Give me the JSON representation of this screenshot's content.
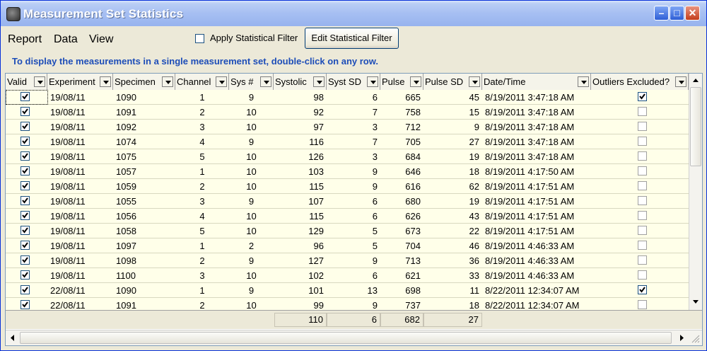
{
  "window": {
    "title": "Measurement Set Statistics"
  },
  "menu": {
    "items": [
      "Report",
      "Data",
      "View"
    ]
  },
  "toolbar": {
    "filter_checkbox_label": "Apply Statistical Filter",
    "filter_checked": false,
    "edit_button_label": "Edit Statistical Filter"
  },
  "info_text": "To display the measurements in a single measurement set, double-click on any row.",
  "columns": [
    "Valid",
    "Experiment",
    "Specimen",
    "Channel",
    "Sys #",
    "Systolic",
    "Syst SD",
    "Pulse",
    "Pulse SD",
    "Date/Time",
    "Outliers Excluded?"
  ],
  "rows": [
    {
      "valid": true,
      "experiment": "19/08/11",
      "specimen": "1090",
      "channel": "1",
      "sys": "9",
      "systolic": "98",
      "syst_sd": "6",
      "pulse": "665",
      "pulse_sd": "45",
      "datetime": "8/19/2011 3:47:18 AM",
      "outliers": true
    },
    {
      "valid": true,
      "experiment": "19/08/11",
      "specimen": "1091",
      "channel": "2",
      "sys": "10",
      "systolic": "92",
      "syst_sd": "7",
      "pulse": "758",
      "pulse_sd": "15",
      "datetime": "8/19/2011 3:47:18 AM",
      "outliers": false
    },
    {
      "valid": true,
      "experiment": "19/08/11",
      "specimen": "1092",
      "channel": "3",
      "sys": "10",
      "systolic": "97",
      "syst_sd": "3",
      "pulse": "712",
      "pulse_sd": "9",
      "datetime": "8/19/2011 3:47:18 AM",
      "outliers": false
    },
    {
      "valid": true,
      "experiment": "19/08/11",
      "specimen": "1074",
      "channel": "4",
      "sys": "9",
      "systolic": "116",
      "syst_sd": "7",
      "pulse": "705",
      "pulse_sd": "27",
      "datetime": "8/19/2011 3:47:18 AM",
      "outliers": false
    },
    {
      "valid": true,
      "experiment": "19/08/11",
      "specimen": "1075",
      "channel": "5",
      "sys": "10",
      "systolic": "126",
      "syst_sd": "3",
      "pulse": "684",
      "pulse_sd": "19",
      "datetime": "8/19/2011 3:47:18 AM",
      "outliers": false
    },
    {
      "valid": true,
      "experiment": "19/08/11",
      "specimen": "1057",
      "channel": "1",
      "sys": "10",
      "systolic": "103",
      "syst_sd": "9",
      "pulse": "646",
      "pulse_sd": "18",
      "datetime": "8/19/2011 4:17:50 AM",
      "outliers": false
    },
    {
      "valid": true,
      "experiment": "19/08/11",
      "specimen": "1059",
      "channel": "2",
      "sys": "10",
      "systolic": "115",
      "syst_sd": "9",
      "pulse": "616",
      "pulse_sd": "62",
      "datetime": "8/19/2011 4:17:51 AM",
      "outliers": false
    },
    {
      "valid": true,
      "experiment": "19/08/11",
      "specimen": "1055",
      "channel": "3",
      "sys": "9",
      "systolic": "107",
      "syst_sd": "6",
      "pulse": "680",
      "pulse_sd": "19",
      "datetime": "8/19/2011 4:17:51 AM",
      "outliers": false
    },
    {
      "valid": true,
      "experiment": "19/08/11",
      "specimen": "1056",
      "channel": "4",
      "sys": "10",
      "systolic": "115",
      "syst_sd": "6",
      "pulse": "626",
      "pulse_sd": "43",
      "datetime": "8/19/2011 4:17:51 AM",
      "outliers": false
    },
    {
      "valid": true,
      "experiment": "19/08/11",
      "specimen": "1058",
      "channel": "5",
      "sys": "10",
      "systolic": "129",
      "syst_sd": "5",
      "pulse": "673",
      "pulse_sd": "22",
      "datetime": "8/19/2011 4:17:51 AM",
      "outliers": false
    },
    {
      "valid": true,
      "experiment": "19/08/11",
      "specimen": "1097",
      "channel": "1",
      "sys": "2",
      "systolic": "96",
      "syst_sd": "5",
      "pulse": "704",
      "pulse_sd": "46",
      "datetime": "8/19/2011 4:46:33 AM",
      "outliers": false
    },
    {
      "valid": true,
      "experiment": "19/08/11",
      "specimen": "1098",
      "channel": "2",
      "sys": "9",
      "systolic": "127",
      "syst_sd": "9",
      "pulse": "713",
      "pulse_sd": "36",
      "datetime": "8/19/2011 4:46:33 AM",
      "outliers": false
    },
    {
      "valid": true,
      "experiment": "19/08/11",
      "specimen": "1100",
      "channel": "3",
      "sys": "10",
      "systolic": "102",
      "syst_sd": "6",
      "pulse": "621",
      "pulse_sd": "33",
      "datetime": "8/19/2011 4:46:33 AM",
      "outliers": false
    },
    {
      "valid": true,
      "experiment": "22/08/11",
      "specimen": "1090",
      "channel": "1",
      "sys": "9",
      "systolic": "101",
      "syst_sd": "13",
      "pulse": "698",
      "pulse_sd": "11",
      "datetime": "8/22/2011 12:34:07 AM",
      "outliers": true
    },
    {
      "valid": true,
      "experiment": "22/08/11",
      "specimen": "1091",
      "channel": "2",
      "sys": "10",
      "systolic": "99",
      "syst_sd": "9",
      "pulse": "737",
      "pulse_sd": "18",
      "datetime": "8/22/2011 12:34:07 AM",
      "outliers": false
    }
  ],
  "totals": {
    "systolic": "110",
    "syst_sd": "6",
    "pulse": "682",
    "pulse_sd": "27"
  },
  "colors": {
    "title_gradient_dark": "#97b3ee",
    "info_text": "#1d4db8",
    "row_bg": "#ffffe9"
  }
}
